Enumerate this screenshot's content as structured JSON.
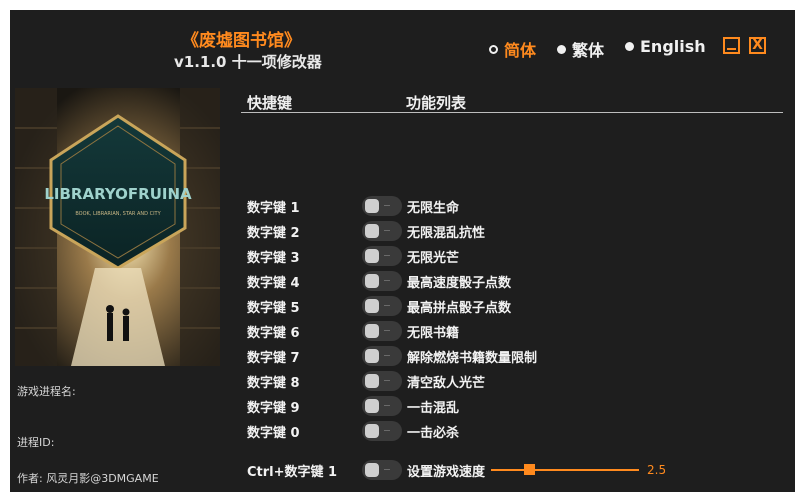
{
  "app": {
    "title": "《废墟图书馆》",
    "subtitle": "v1.1.0 十一项修改器"
  },
  "languages": [
    {
      "label": "简体",
      "selected": true
    },
    {
      "label": "繁体",
      "selected": false
    },
    {
      "label": "English",
      "selected": false
    }
  ],
  "window_buttons": {
    "close_glyph": "X"
  },
  "cover": {
    "logo_text": "LIBRARYOFRUINA",
    "tagline": "BOOK, LIBRARIAN, STAR AND CITY"
  },
  "info": {
    "process_name_label": "游戏进程名:",
    "process_id_label": "进程ID:",
    "author": "作者: 风灵月影@3DMGAME"
  },
  "headers": {
    "hotkey": "快捷键",
    "features": "功能列表"
  },
  "cheats": [
    {
      "key": "数字键 1",
      "name": "无限生命"
    },
    {
      "key": "数字键 2",
      "name": "无限混乱抗性"
    },
    {
      "key": "数字键 3",
      "name": "无限光芒"
    },
    {
      "key": "数字键 4",
      "name": "最高速度骰子点数"
    },
    {
      "key": "数字键 5",
      "name": "最高拼点骰子点数"
    },
    {
      "key": "数字键 6",
      "name": "无限书籍"
    },
    {
      "key": "数字键 7",
      "name": "解除燃烧书籍数量限制"
    },
    {
      "key": "数字键 8",
      "name": "清空敌人光芒"
    },
    {
      "key": "数字键 9",
      "name": "一击混乱"
    },
    {
      "key": "数字键 0",
      "name": "一击必杀"
    }
  ],
  "speed": {
    "key": "Ctrl+数字键 1",
    "name": "设置游戏速度",
    "value": "2.5"
  },
  "colors": {
    "accent": "#ff8a1e",
    "background": "#1e1e1e",
    "text": "#f2f2f2"
  }
}
